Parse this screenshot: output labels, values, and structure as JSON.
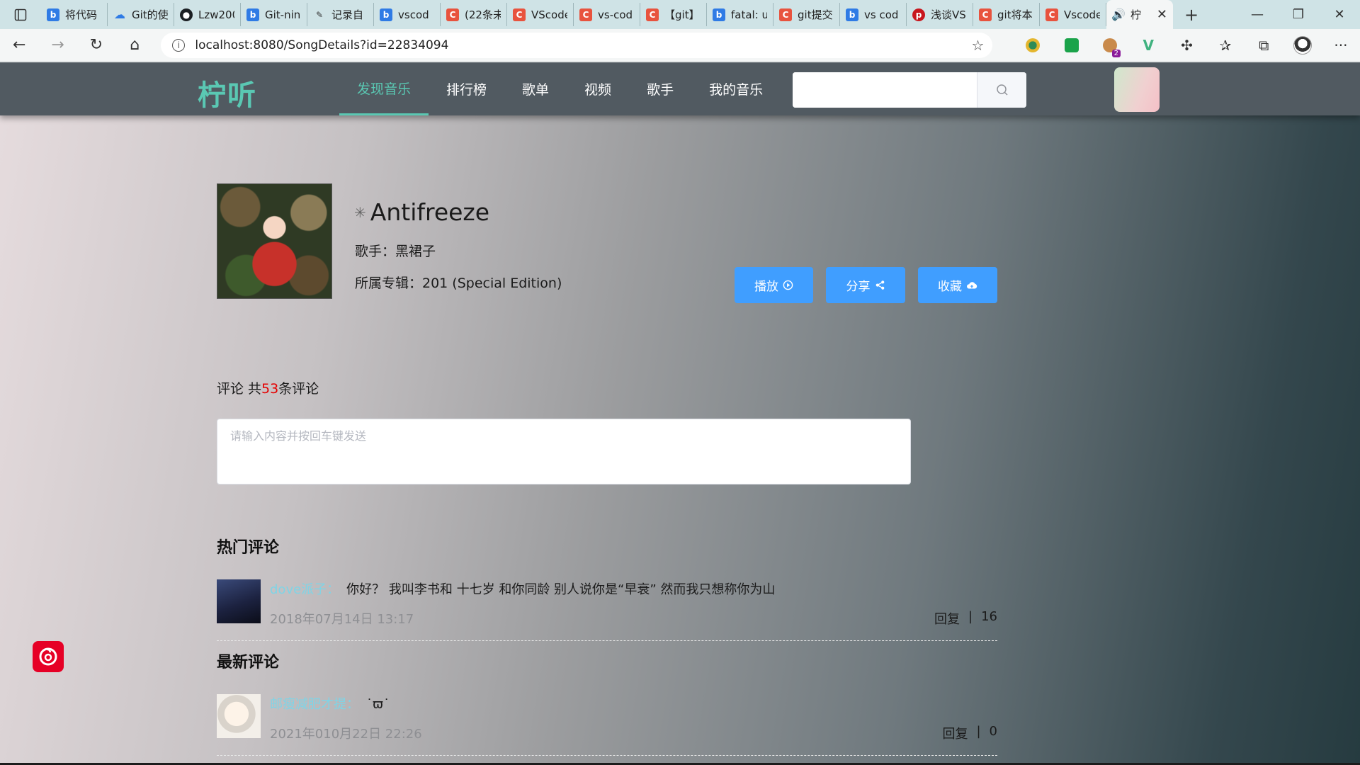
{
  "browser": {
    "tabs": [
      {
        "label": "将代码",
        "favicon": "bing-b",
        "color": "#2f7be5"
      },
      {
        "label": "Git的使",
        "favicon": "cloud-icon",
        "color": "#2f7be5"
      },
      {
        "label": "Lzw200",
        "favicon": "github-icon",
        "color": "#1b1f23"
      },
      {
        "label": "Git-nin",
        "favicon": "bing-b",
        "color": "#2f7be5"
      },
      {
        "label": "记录自",
        "favicon": "feather-icon",
        "color": "#333333"
      },
      {
        "label": "vscod",
        "favicon": "bing-b",
        "color": "#2f7be5"
      },
      {
        "label": "(22条未",
        "favicon": "csdn-c",
        "color": "#e8533e"
      },
      {
        "label": "VScode",
        "favicon": "csdn-c",
        "color": "#e8533e"
      },
      {
        "label": "vs-cod",
        "favicon": "csdn-c",
        "color": "#e8533e"
      },
      {
        "label": "【git】",
        "favicon": "csdn-c",
        "color": "#e8533e"
      },
      {
        "label": "fatal: u",
        "favicon": "bing-b",
        "color": "#2f7be5"
      },
      {
        "label": "git提交",
        "favicon": "csdn-c",
        "color": "#e8533e"
      },
      {
        "label": "vs cod",
        "favicon": "bing-b",
        "color": "#2f7be5"
      },
      {
        "label": "浅谈VS",
        "favicon": "php-icon",
        "color": "#c8161d"
      },
      {
        "label": "git将本",
        "favicon": "csdn-c",
        "color": "#e8533e"
      },
      {
        "label": "Vscode",
        "favicon": "csdn-c",
        "color": "#e8533e"
      }
    ],
    "active_tab": {
      "label": "柠",
      "favicon": "speaker-icon"
    },
    "url": "localhost:8080/SongDetails?id=22834094"
  },
  "site": {
    "logo": "柠听",
    "nav": [
      "发现音乐",
      "排行榜",
      "歌单",
      "视频",
      "歌手",
      "我的音乐"
    ],
    "active_nav": 0,
    "search_placeholder": "",
    "accent": "#5ac8b3"
  },
  "song": {
    "title": "Antifreeze",
    "singer": "歌手：黑裙子",
    "album": "所属专辑：201 (Special Edition)"
  },
  "actions": {
    "play": "播放",
    "share": "分享",
    "collect": "收藏",
    "color": "#409eff"
  },
  "comments": {
    "count_prefix": "评论 共",
    "count": "53",
    "count_suffix": "条评论",
    "input_placeholder": "请输入内容并按回车键发送",
    "hot_title": "热门评论",
    "new_title": "最新评论",
    "hot": {
      "user": "dove派子：",
      "text": "你好？ 我叫李书和 十七岁 和你同龄 别人说你是“早衰” 然而我只想称你为山",
      "time": "2018年07月14日 13:17",
      "reply": "回复",
      "likes": "16"
    },
    "latest": {
      "user": "邮瘦减肥才提：",
      "text": "˙ϖ˙",
      "time": "2021年010月22日 22:26",
      "reply": "回复",
      "likes": "0"
    }
  }
}
